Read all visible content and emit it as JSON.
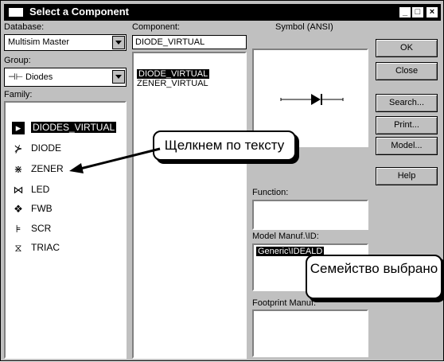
{
  "window": {
    "title": "Select a Component",
    "minimize_glyph": "_",
    "maximize_glyph": "□",
    "close_glyph": "×"
  },
  "left": {
    "database_label": "Database:",
    "database_value": "Multisim Master",
    "group_label": "Group:",
    "group_value": "Diodes",
    "family_label": "Family:",
    "family_items": [
      {
        "label": "DIODES_VIRTUAL",
        "icon": "diode-virtual-icon",
        "selected": true
      },
      {
        "label": "DIODE",
        "icon": "diode-icon",
        "selected": false
      },
      {
        "label": "ZENER",
        "icon": "zener-icon",
        "selected": false
      },
      {
        "label": "LED",
        "icon": "led-icon",
        "selected": false
      },
      {
        "label": "FWB",
        "icon": "bridge-icon",
        "selected": false
      },
      {
        "label": "SCR",
        "icon": "scr-icon",
        "selected": false
      },
      {
        "label": "TRIAC",
        "icon": "triac-icon",
        "selected": false
      }
    ]
  },
  "middle": {
    "component_label": "Component:",
    "component_value": "DIODE_VIRTUAL",
    "component_items": [
      "DIODE_VIRTUAL",
      "ZENER_VIRTUAL"
    ]
  },
  "right": {
    "symbol_label": "Symbol (ANSI)",
    "function_label": "Function:",
    "model_label": "Model Manuf.\\ID:",
    "model_selected": "Generic\\IDEALD",
    "footprint_label": "Footprint Manuf."
  },
  "buttons": {
    "ok": "OK",
    "close": "Close",
    "search": "Search...",
    "print": "Print...",
    "model": "Model...",
    "help": "Help"
  },
  "annotations": {
    "click_text": "Щелкнем по тексту",
    "family_selected": "Семейство выбрано"
  }
}
